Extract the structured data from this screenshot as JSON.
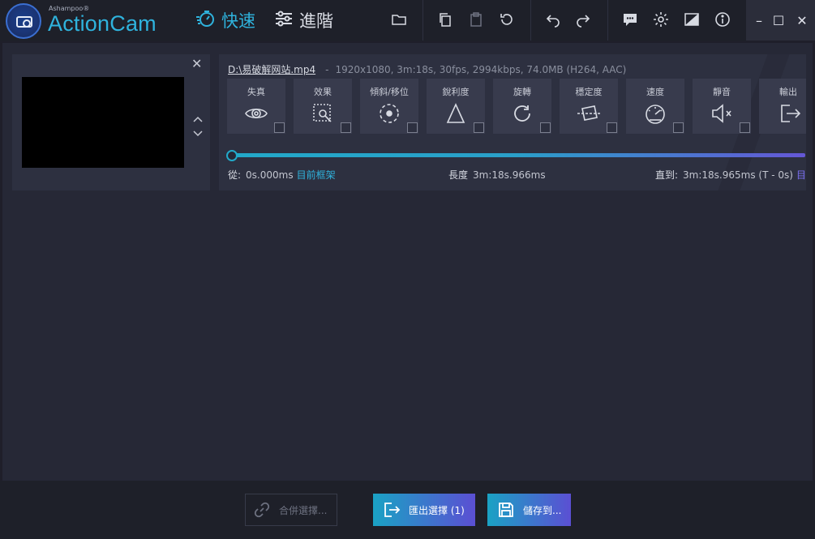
{
  "app": {
    "vendor": "Ashampoo®",
    "name": "ActionCam"
  },
  "modes": {
    "quick": "快速",
    "advanced": "進階"
  },
  "toolbar_icons": [
    "folder-icon",
    "copy-icon",
    "paste-icon",
    "reset-icon",
    "undo-icon",
    "redo-icon",
    "feedback-icon",
    "gear-icon",
    "theme-icon",
    "info-icon"
  ],
  "window": {
    "minimize": "–",
    "maximize": "☐",
    "close": "✕"
  },
  "clip": {
    "file_name": "D:\\易破解网站.mp4",
    "dash": "-",
    "meta": "1920x1080, 3m:18s, 30fps, 2994kbps, 74.0MB (H264, AAC)"
  },
  "tools": [
    {
      "label": "失真",
      "icon": "eye-icon"
    },
    {
      "label": "效果",
      "icon": "effects-icon"
    },
    {
      "label": "傾斜/移位",
      "icon": "tilt-shift-icon"
    },
    {
      "label": "銳利度",
      "icon": "sharpness-icon"
    },
    {
      "label": "旋轉",
      "icon": "rotate-icon"
    },
    {
      "label": "穩定度",
      "icon": "stabilize-icon"
    },
    {
      "label": "速度",
      "icon": "speedometer-icon"
    },
    {
      "label": "靜音",
      "icon": "mute-icon"
    },
    {
      "label": "輸出",
      "icon": "output-icon"
    }
  ],
  "timing": {
    "from_label": "從:",
    "from_value": "0s.000ms",
    "from_link": "目前框架",
    "length_label": "長度",
    "length_value": "3m:18s.966ms",
    "to_label": "直到:",
    "to_value": "3m:18s.965ms (T - 0s)",
    "to_link": "目前框"
  },
  "actions": {
    "merge": "合併選擇...",
    "export": "匯出選擇 (1)",
    "save": "儲存到..."
  },
  "colors": {
    "accent_cyan": "#2fb3dd",
    "accent_purple": "#5b4fd3",
    "background": "#262836"
  }
}
